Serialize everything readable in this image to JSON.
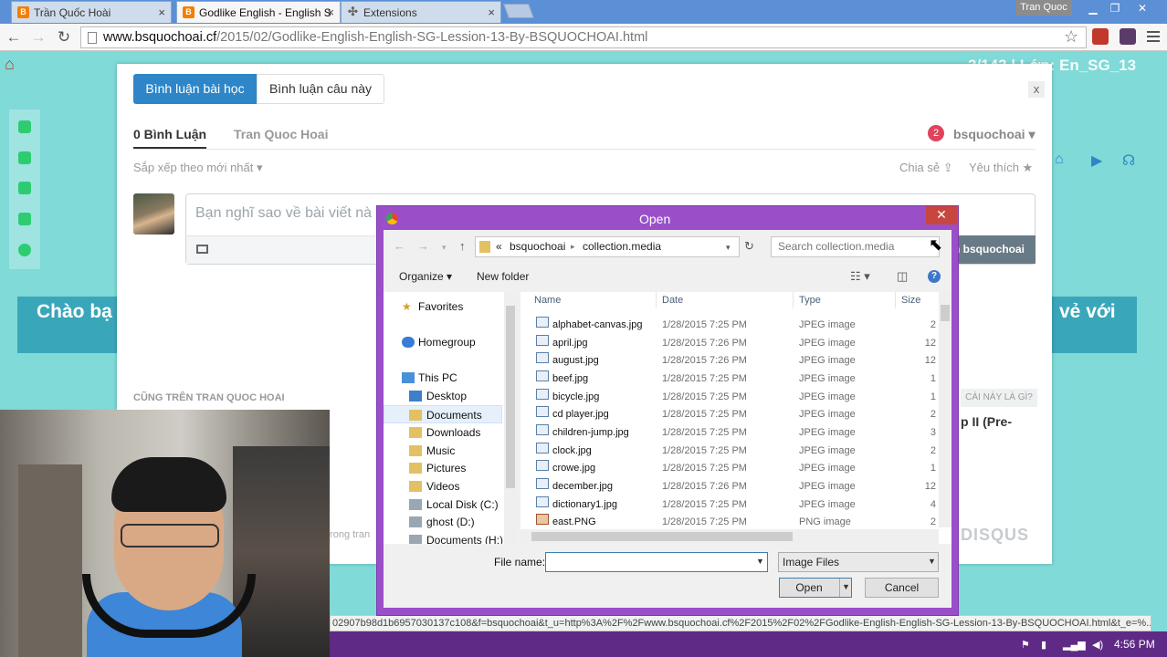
{
  "browser": {
    "tabs": [
      {
        "label": "Trần Quốc Hoài",
        "icon": "blogger-icon"
      },
      {
        "label": "Godlike English - English S",
        "icon": "blogger-icon"
      },
      {
        "label": "Extensions",
        "icon": "puzzle-icon"
      }
    ],
    "tab_close": "×",
    "user": "Tran Quoc",
    "url_host": "www.bsquochoai.cf",
    "url_path": "/2015/02/Godlike-English-English-SG-Lession-13-By-BSQUOCHOAI.html",
    "back": "←",
    "forward": "→",
    "reload": "↻",
    "star": "☆",
    "win_min": "▁",
    "win_max": "❐",
    "win_close": "✕"
  },
  "page": {
    "lesson_tag": "3/143 | Lớp: En_SG_13",
    "banner_left": "Chào bạ",
    "banner_right": "vẻ với"
  },
  "disqus": {
    "segment_active": "Bình luận bài học",
    "segment_other": "Bình luận câu này",
    "close": "x",
    "tab_comments": "0 Bình Luận",
    "tab_site": "Tran Quoc Hoai",
    "notif_count": "2",
    "username": "bsquochoai ▾",
    "sort": "Sắp xếp theo mới nhất ▾",
    "share": "Chia sẻ ⇪",
    "like": "Yêu thích ★",
    "placeholder": "Bạn nghĩ sao về bài viết nà",
    "post_btn": "n bsquochoai",
    "also_on": "CŨNG TRÊN TRAN QUOC HOAI",
    "what_is": "CÁI NÀY LÀ GÌ?",
    "article": "p II (Pre-",
    "brand": "DISQUS",
    "trang": "trong tran"
  },
  "dialog": {
    "title": "Open",
    "close": "✕",
    "breadcrumb_prefix": "«",
    "breadcrumb": [
      "bsquochoai",
      "collection.media"
    ],
    "search_placeholder": "Search collection.media",
    "organize": "Organize ▾",
    "new_folder": "New folder",
    "help": "?",
    "nav": [
      {
        "label": "Favorites",
        "icon": "star-icon"
      },
      {
        "label": "Homegroup",
        "icon": "homegroup-icon"
      },
      {
        "label": "This PC",
        "icon": "computer-icon"
      },
      {
        "label": "Desktop",
        "icon": "folder-icon"
      },
      {
        "label": "Documents",
        "icon": "folder-icon"
      },
      {
        "label": "Downloads",
        "icon": "folder-icon"
      },
      {
        "label": "Music",
        "icon": "folder-icon"
      },
      {
        "label": "Pictures",
        "icon": "folder-icon"
      },
      {
        "label": "Videos",
        "icon": "folder-icon"
      },
      {
        "label": "Local Disk (C:)",
        "icon": "drive-icon"
      },
      {
        "label": "ghost (D:)",
        "icon": "drive-icon"
      },
      {
        "label": "Documents (H:)",
        "icon": "drive-icon"
      }
    ],
    "columns": {
      "name": "Name",
      "date": "Date",
      "type": "Type",
      "size": "Size"
    },
    "files": [
      {
        "name": "alphabet-canvas.jpg",
        "date": "1/28/2015 7:25 PM",
        "type": "JPEG image",
        "size": "2"
      },
      {
        "name": "april.jpg",
        "date": "1/28/2015 7:26 PM",
        "type": "JPEG image",
        "size": "12"
      },
      {
        "name": "august.jpg",
        "date": "1/28/2015 7:26 PM",
        "type": "JPEG image",
        "size": "12"
      },
      {
        "name": "beef.jpg",
        "date": "1/28/2015 7:25 PM",
        "type": "JPEG image",
        "size": "1"
      },
      {
        "name": "bicycle.jpg",
        "date": "1/28/2015 7:25 PM",
        "type": "JPEG image",
        "size": "1"
      },
      {
        "name": "cd player.jpg",
        "date": "1/28/2015 7:25 PM",
        "type": "JPEG image",
        "size": "2"
      },
      {
        "name": "children-jump.jpg",
        "date": "1/28/2015 7:25 PM",
        "type": "JPEG image",
        "size": "3"
      },
      {
        "name": "clock.jpg",
        "date": "1/28/2015 7:25 PM",
        "type": "JPEG image",
        "size": "2"
      },
      {
        "name": "crowe.jpg",
        "date": "1/28/2015 7:25 PM",
        "type": "JPEG image",
        "size": "1"
      },
      {
        "name": "december.jpg",
        "date": "1/28/2015 7:26 PM",
        "type": "JPEG image",
        "size": "12"
      },
      {
        "name": "dictionary1.jpg",
        "date": "1/28/2015 7:25 PM",
        "type": "JPEG image",
        "size": "4"
      },
      {
        "name": "east.PNG",
        "date": "1/28/2015 7:25 PM",
        "type": "PNG image",
        "size": "2"
      }
    ],
    "file_name_label": "File name:",
    "file_name_value": "",
    "file_type": "Image Files",
    "open_btn": "Open",
    "cancel_btn": "Cancel"
  },
  "status_url": "02907b98d1b6957030137c108&f=bsquochoai&t_u=http%3A%2F%2Fwww.bsquochoai.cf%2F2015%2F02%2FGodlike-English-English-SG-Lession-13-By-BSQUOCHOAI.html&t_e=%...",
  "taskbar": {
    "clock": "4:56 PM"
  },
  "colors": {
    "accent": "#2e86c8",
    "dialog_frame": "#9a4fc9",
    "page_bg": "#7fdad8"
  }
}
